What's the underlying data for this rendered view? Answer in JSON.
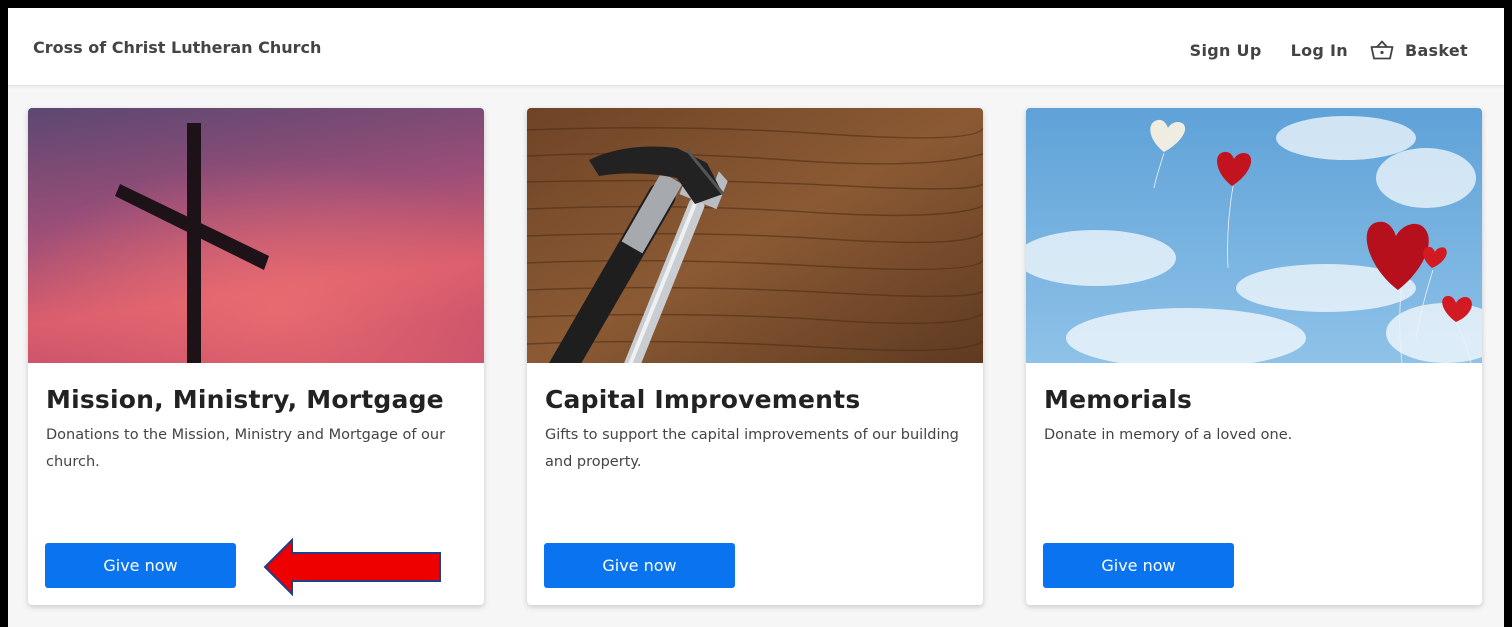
{
  "header": {
    "brand": "Cross of Christ Lutheran Church",
    "nav": {
      "signup": "Sign Up",
      "login": "Log In",
      "basket": "Basket"
    }
  },
  "cards": [
    {
      "title": "Mission, Ministry, Mortgage",
      "description": "Donations to the Mission, Ministry and Mortgage of our church.",
      "button": "Give now",
      "image": "cross-at-sunset-image"
    },
    {
      "title": "Capital Improvements",
      "description": "Gifts to support the capital improvements of our building and property.",
      "button": "Give now",
      "image": "hammer-and-wrench-image"
    },
    {
      "title": "Memorials",
      "description": "Donate in memory of a loved one.",
      "button": "Give now",
      "image": "heart-balloons-image"
    }
  ],
  "colors": {
    "button": "#0a74f0",
    "annotation_arrow": "#ee0000"
  },
  "annotation": {
    "icon": "red-arrow-icon",
    "points_to": "give-now-button"
  }
}
